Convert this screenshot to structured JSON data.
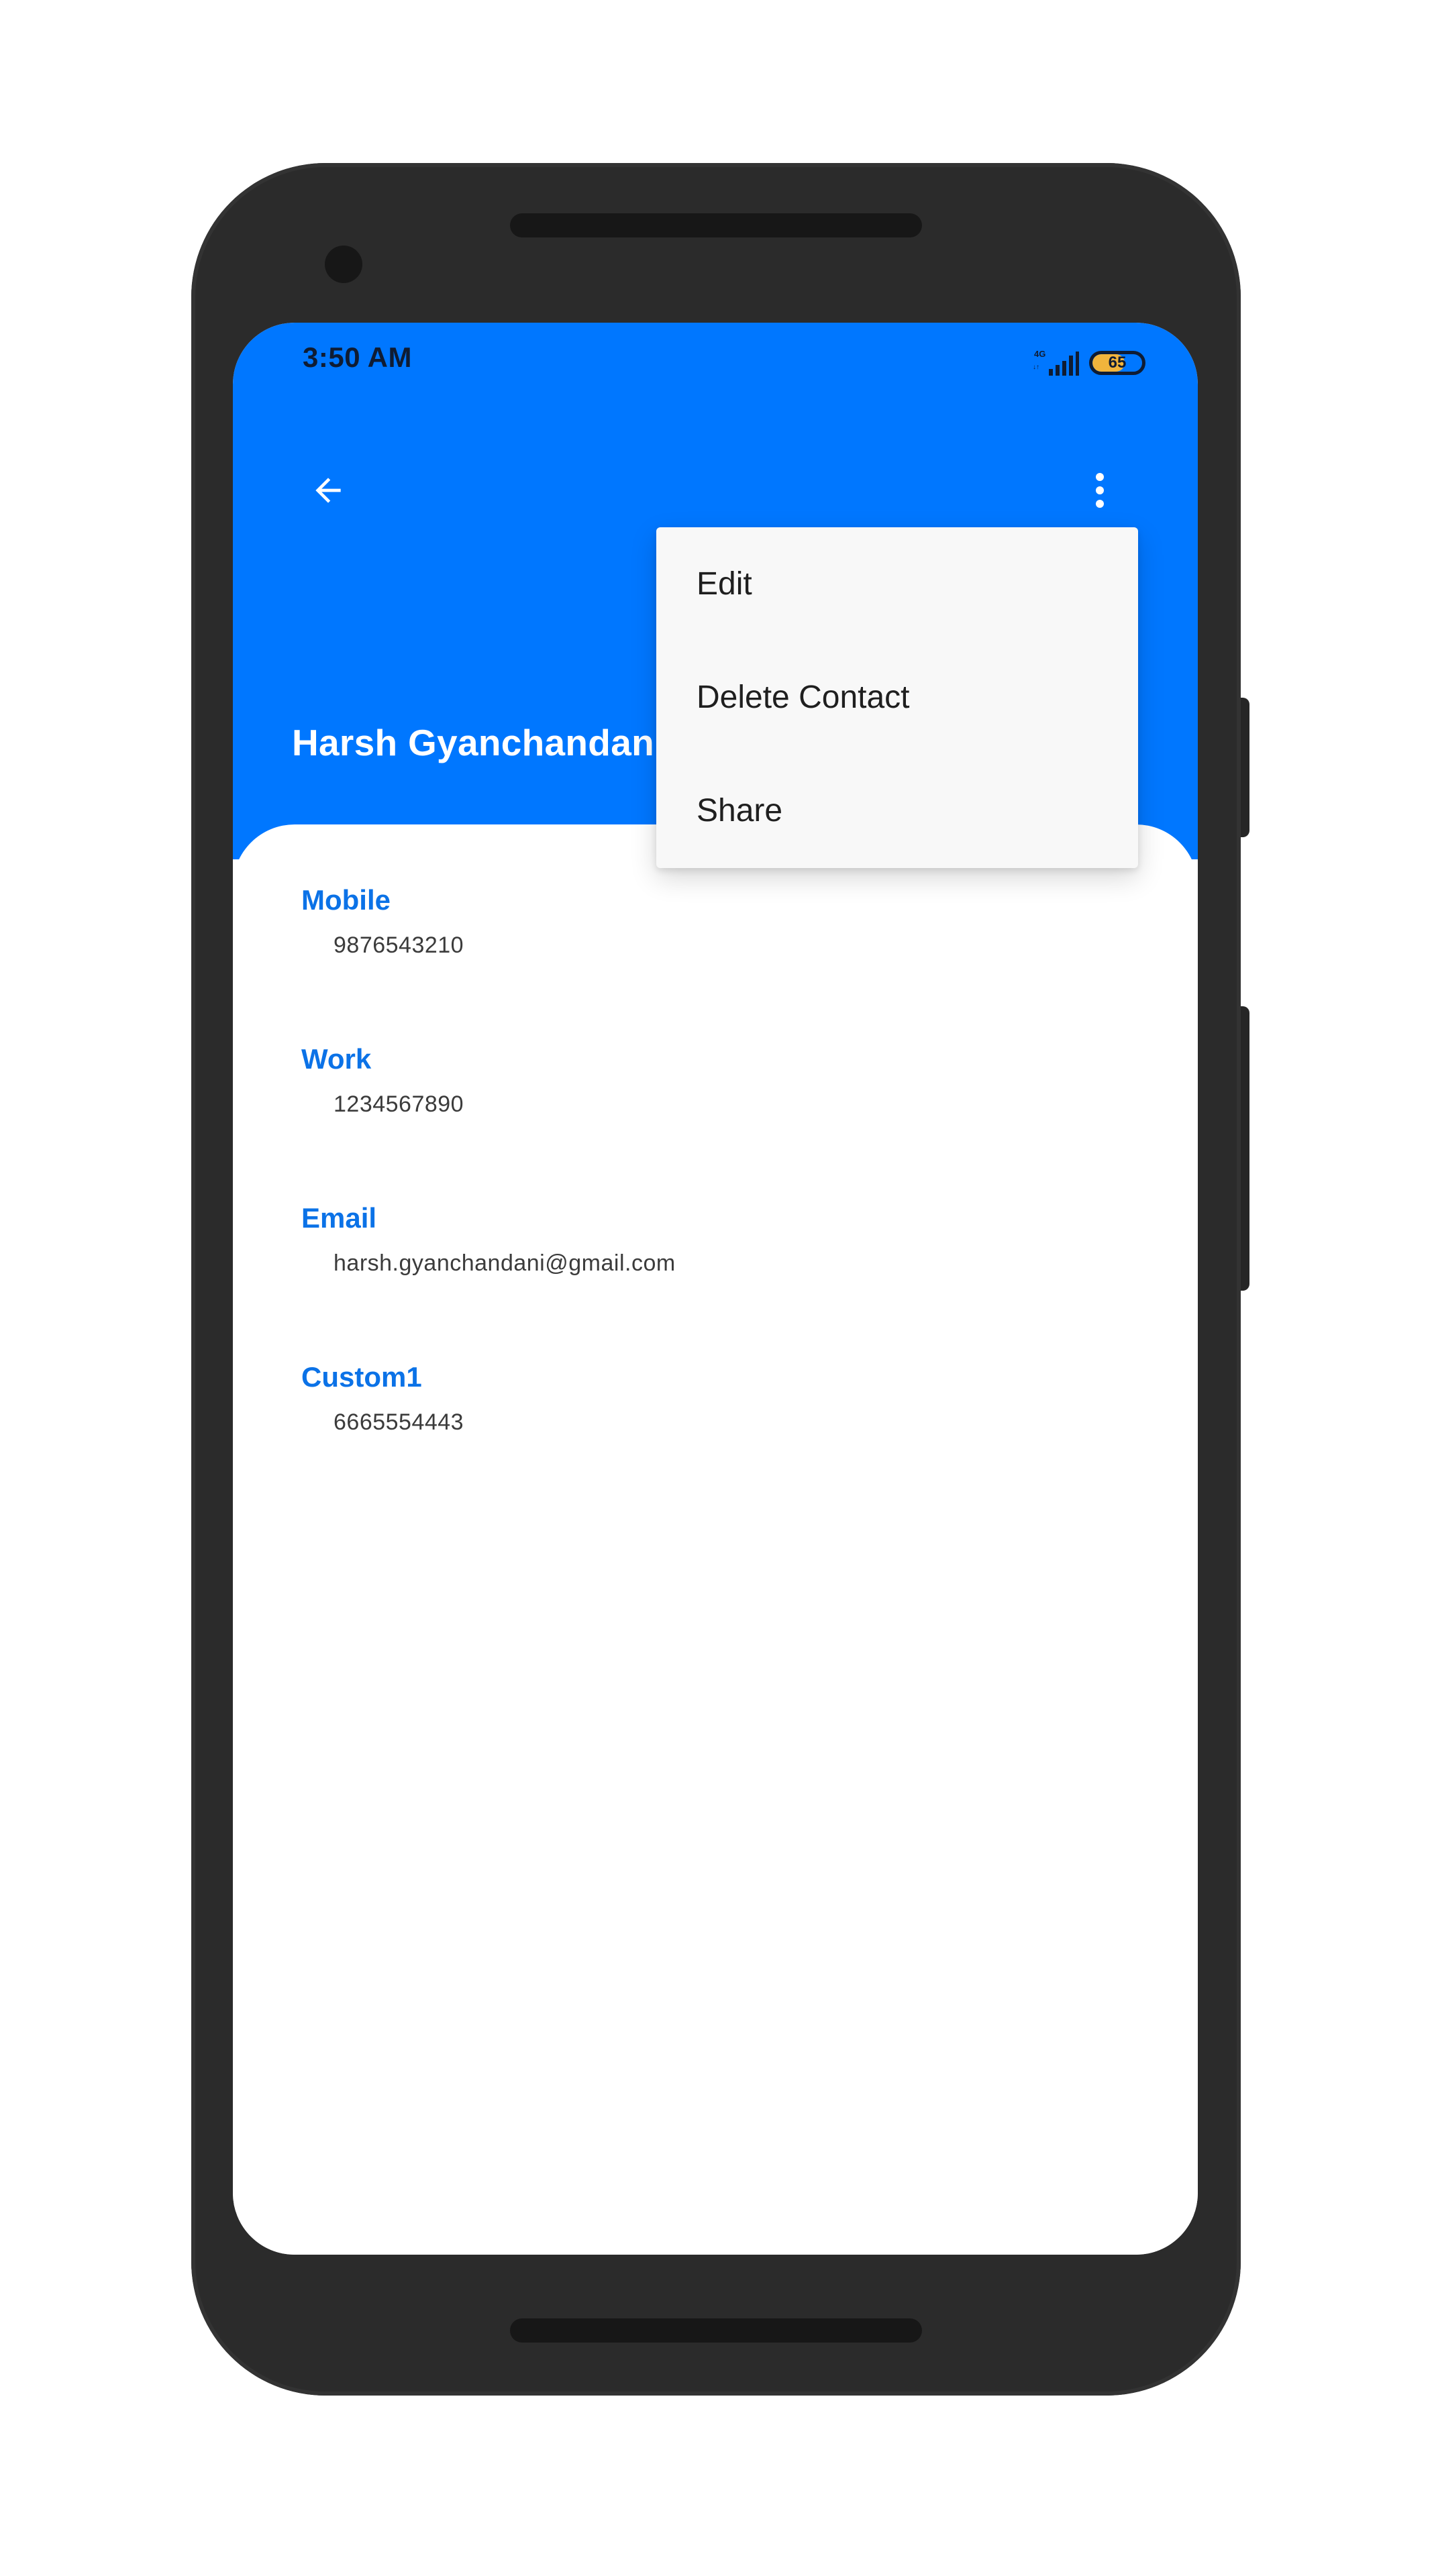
{
  "status_bar": {
    "time": "3:50 AM",
    "network_label": "4G",
    "battery_level": "65"
  },
  "header": {
    "back_icon": "arrow-left-icon",
    "more_icon": "more-vertical-icon",
    "contact_name": "Harsh Gyanchandani",
    "background_color": "#0077ff"
  },
  "overflow_menu": {
    "items": [
      {
        "label": "Edit"
      },
      {
        "label": "Delete Contact"
      },
      {
        "label": "Share"
      }
    ]
  },
  "details": {
    "fields": [
      {
        "label": "Mobile",
        "value": "9876543210"
      },
      {
        "label": "Work",
        "value": "1234567890"
      },
      {
        "label": "Email",
        "value": "harsh.gyanchandani@gmail.com"
      },
      {
        "label": "Custom1",
        "value": "6665554443"
      }
    ],
    "label_color": "#0b72e7"
  }
}
